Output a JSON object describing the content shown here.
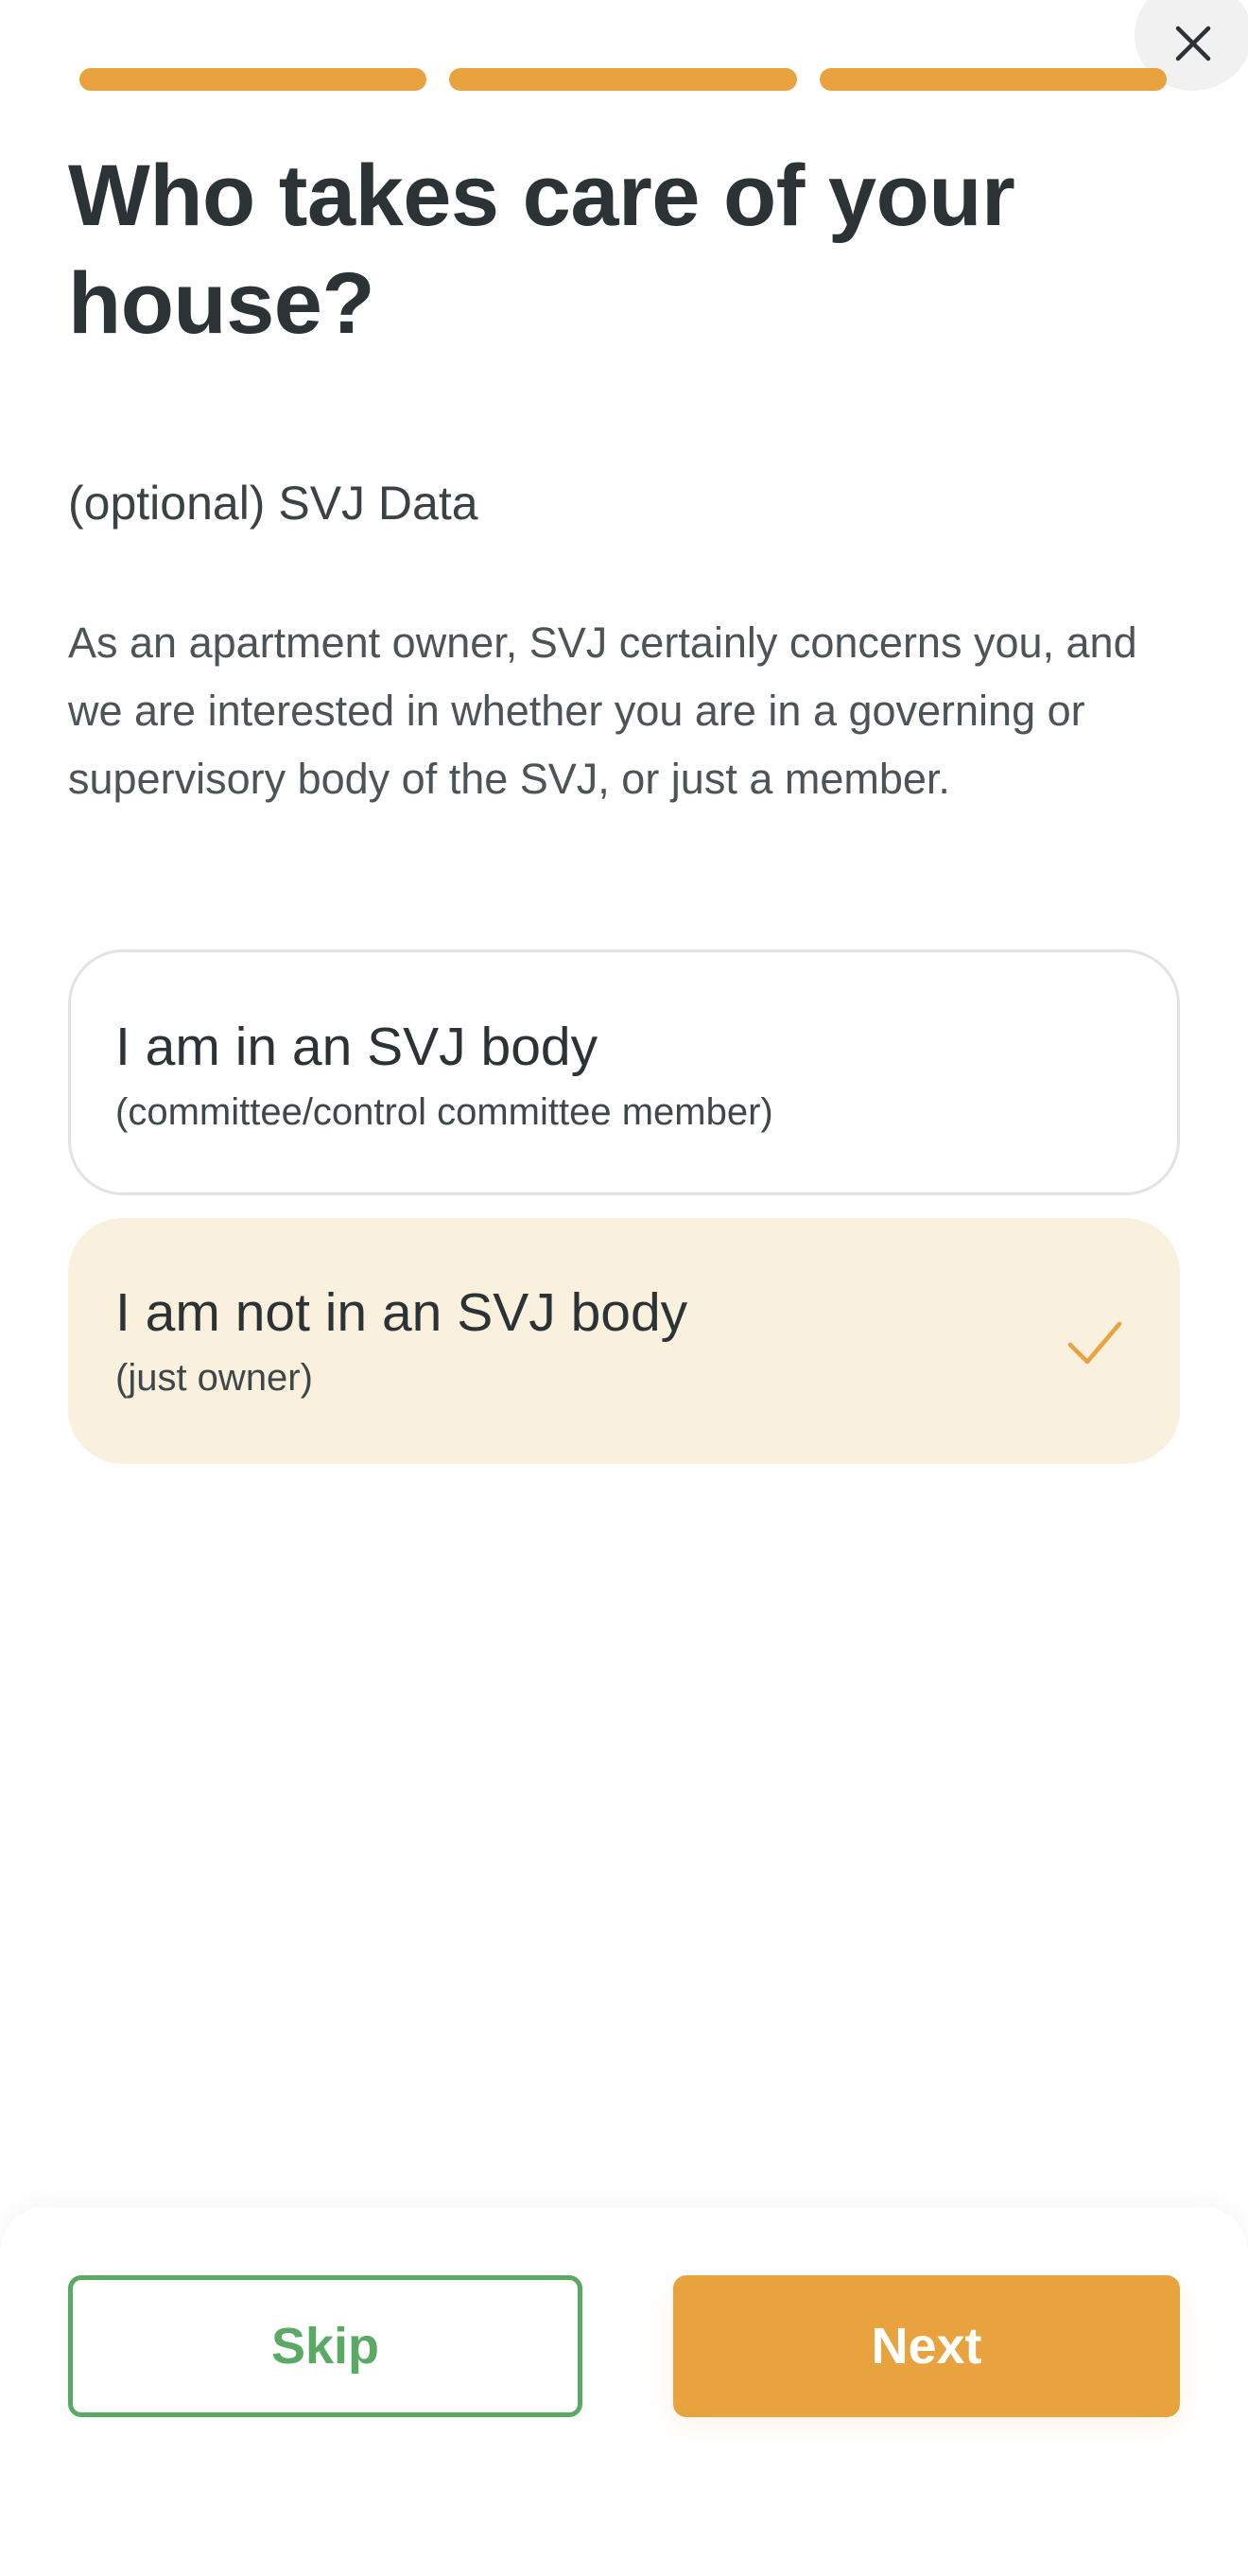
{
  "header": {
    "close_icon": "close-icon",
    "progress_steps": 3,
    "progress_completed": 3
  },
  "title": "Who takes care of your house?",
  "section_label": "(optional) SVJ Data",
  "description": "As an apartment owner, SVJ certainly concerns you, and we are interested in whether you are in a governing or supervisory body of the SVJ, or just a member.",
  "options": [
    {
      "title": "I am in an SVJ body",
      "subtitle": "(committee/control committee member)",
      "selected": false
    },
    {
      "title": "I am not in an SVJ body",
      "subtitle": "(just owner)",
      "selected": true
    }
  ],
  "footer": {
    "skip_label": "Skip",
    "next_label": "Next"
  },
  "colors": {
    "accent": "#e8a23e",
    "selected_bg": "#f9f0de",
    "skip_green": "#5aaa66",
    "text_dark": "#2b3336"
  }
}
